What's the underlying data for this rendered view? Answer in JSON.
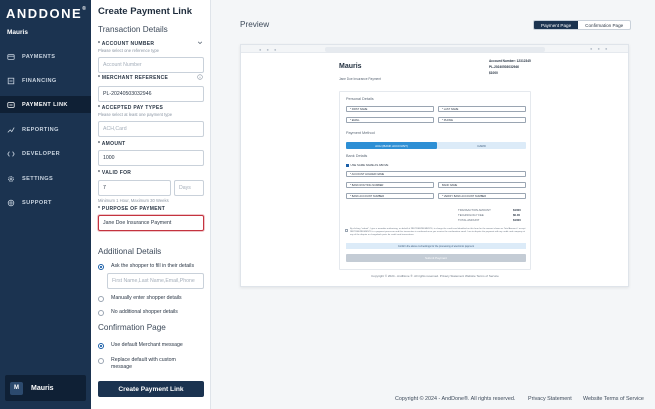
{
  "app": {
    "logo": "ANDDONE",
    "logo_mark": "®",
    "org_name": "Mauris"
  },
  "sidebar": {
    "items": [
      {
        "label": "PAYMENTS",
        "icon": "payments-icon"
      },
      {
        "label": "FINANCING",
        "icon": "financing-icon"
      },
      {
        "label": "PAYMENT LINK",
        "icon": "payment-link-icon",
        "active": true
      },
      {
        "label": "REPORTING",
        "icon": "reporting-icon"
      },
      {
        "label": "DEVELOPER",
        "icon": "developer-icon"
      },
      {
        "label": "SETTINGS",
        "icon": "gear-icon"
      },
      {
        "label": "SUPPORT",
        "icon": "support-icon"
      }
    ],
    "user": {
      "initial": "M",
      "name": "Mauris"
    }
  },
  "form": {
    "title": "Create Payment Link",
    "transaction_details": "Transaction Details",
    "account_number": {
      "label": "* ACCOUNT NUMBER",
      "help": "Please select one reference type",
      "placeholder": "Account Number"
    },
    "merchant_reference": {
      "label": "* MERCHANT REFERENCE",
      "value": "PL-20240503032946"
    },
    "accepted_pay_types": {
      "label": "* ACCEPTED PAY TYPES",
      "help": "Please select at least one payment type",
      "value": "ACH,Card"
    },
    "amount": {
      "label": "* AMOUNT",
      "value": "1000"
    },
    "valid_for": {
      "label": "* VALID FOR",
      "value": "7",
      "unit": "Days",
      "help": "Minimum 1 Hour, Maximum 30 Weeks"
    },
    "purpose": {
      "label": "* PURPOSE OF PAYMENT",
      "value": "Jane Doe Insurance Payment"
    },
    "additional_details": "Additional Details",
    "additional_options": [
      {
        "label": "Ask the shopper to fill in their details",
        "selected": true
      },
      {
        "label": "Manually enter shopper details",
        "selected": false
      },
      {
        "label": "No additional shopper details",
        "selected": false
      }
    ],
    "shopper_fields_placeholder": "First Name,Last Name,Email,Phone",
    "confirmation_page": "Confirmation Page",
    "confirmation_options": [
      {
        "label": "Use default Merchant message",
        "selected": true
      },
      {
        "label": "Replace default with custom message",
        "selected": false
      }
    ],
    "create_button": "Create Payment Link"
  },
  "preview": {
    "label": "Preview",
    "toggle": {
      "payment_page": "Payment Page",
      "confirmation_page": "Confirmation Page"
    },
    "company": "Mauris",
    "subtitle": "Jane Doe Insurance Payment",
    "meta": [
      "Account Number: 12312345",
      "PL-20240503032946",
      "$1000"
    ],
    "personal_details": "Personal Details",
    "fields": {
      "first_name": "* FIRST NAME",
      "last_name": "* LAST NAME",
      "email": "* EMAIL",
      "phone": "* PHONE",
      "account_holder": "* ACCOUNT HOLDER NAME",
      "routing": "* BANK ROUTING NUMBER",
      "bank_name": "BANK NAME",
      "account_number": "* BANK ACCOUNT NUMBER",
      "verify_account": "* VERIFY BANK ACCOUNT NUMBER"
    },
    "payment_method": "Payment Method",
    "tabs": {
      "ach": "ACH (BANK ACCOUNT)",
      "card": "CARD"
    },
    "bank_details": "Bank Details",
    "same_as_above": "USE SAME NAME AS ABOVE",
    "summary": [
      {
        "label": "TRANSACTION AMOUNT",
        "value": "$1000"
      },
      {
        "label": "TECHNOLOGY FEE",
        "value": "$0.00"
      },
      {
        "label": "TOTAL AMOUNT",
        "value": "$1000"
      }
    ],
    "terms": "By clicking \"submit\", I give a mandate authorizing, on behalf of PAYTREEPAYMENTS, to charge the credit card identified on this form for the amount shown as Total Amount. I accept PAYTREEPAYMENTS is a payment processor and this transaction is confirmed once you receive the confirmation email. I am to dispute the payment with my credit card company at any of the dispute or chargeback ports for credit card transactions.",
    "note": "Confirm the above 4-checkings for the processing of electronic payment",
    "submit": "Submit Payment",
    "footer": "Copyright © 2024 - AndDone ®. All rights reserved.   Privacy Statement   Website Terms of Service"
  },
  "footer": {
    "copyright": "Copyright © 2024 - AndDone®. All rights reserved.",
    "privacy": "Privacy Statement",
    "terms": "Website Terms of Service"
  },
  "colors": {
    "sidebar": "#1b3350",
    "accent": "#2d8fd5",
    "highlight": "#c4333f"
  }
}
